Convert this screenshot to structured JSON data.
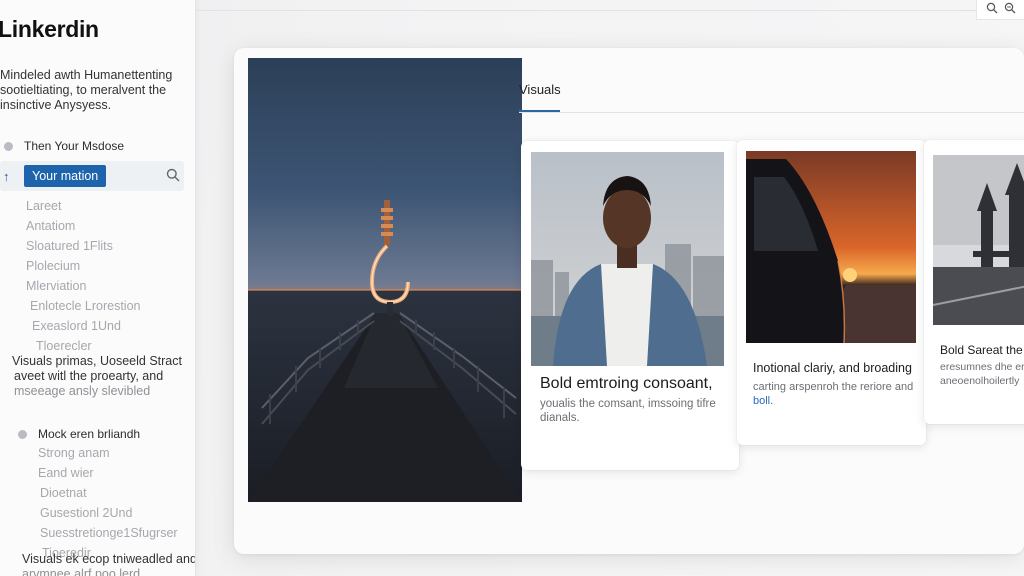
{
  "app": {
    "brand": "Linkerdin"
  },
  "sidebar": {
    "tagline": [
      "Mindeled awth Humanettenting",
      "sootieltiating, to meralvent the",
      "insinctive Anysyess."
    ],
    "section_1": "Then Your Msdose",
    "active_item": "Your mation",
    "items_1": [
      "Lareet",
      "Antatiom",
      "Sloatured 1Flits",
      "Plolecium",
      "Mlerviation",
      "Enlotecle Lrorestion",
      "Exeaslord 1Und",
      "Tloerecler"
    ],
    "para_1": [
      "Visuals primas, Uoseeld Stract",
      "aveet witl the proearty, and",
      "mseeage ansly slevibled"
    ],
    "section_2": "Mock eren brliandh",
    "items_2": [
      "Strong anam",
      "Eand wier",
      "Dioetnat",
      "Gusestionl 2Und",
      "Suesstretionge1Sfugrser",
      "Tioeredir"
    ],
    "para_2": [
      "Visuals ek ecop tniweadled and",
      "arvmnee alrf poo lerd"
    ]
  },
  "main": {
    "tab_visuals": "Visuals",
    "cards": [
      {
        "title": "Bold emtroing consoant,",
        "desc": [
          "youalis the comsant, imssoing tifre",
          "dianals."
        ]
      },
      {
        "title": "Inotional clariy, and broading",
        "desc": [
          "carting arspenroh the reriore and",
          "boll."
        ]
      },
      {
        "title": "Bold Sareat the Scc",
        "desc": [
          "eresumnes dhe erty",
          "aneoenolhoilertly"
        ]
      }
    ]
  },
  "icons": {
    "top_search": "search-icon",
    "top_zoom": "zoom-icon",
    "sidebar_search": "search-icon",
    "active_arrow": "arrow-up-icon"
  },
  "colors": {
    "accent": "#1d64ad",
    "tab_underline": "#2f66a5"
  }
}
